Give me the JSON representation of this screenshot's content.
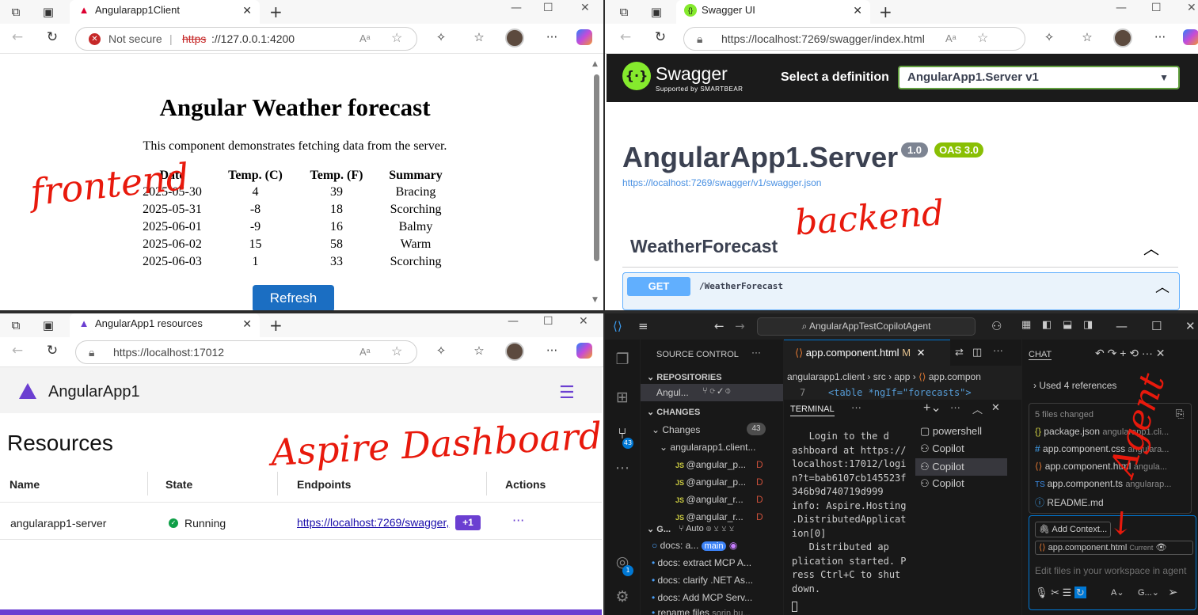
{
  "top_left": {
    "tab_title": "Angularapp1Client",
    "url_warning": "Not secure",
    "url_scheme": "https",
    "url_rest": "://127.0.0.1:4200",
    "heading": "Angular Weather forecast",
    "intro": "This component demonstrates fetching data from the server.",
    "columns": [
      "Date",
      "Temp. (C)",
      "Temp. (F)",
      "Summary"
    ],
    "rows": [
      [
        "2025-05-30",
        "4",
        "39",
        "Bracing"
      ],
      [
        "2025-05-31",
        "-8",
        "18",
        "Scorching"
      ],
      [
        "2025-06-01",
        "-9",
        "16",
        "Balmy"
      ],
      [
        "2025-06-02",
        "15",
        "58",
        "Warm"
      ],
      [
        "2025-06-03",
        "1",
        "33",
        "Scorching"
      ]
    ],
    "refresh_label": "Refresh",
    "annotation": "frontend"
  },
  "top_right": {
    "tab_title": "Swagger UI",
    "url": "https://localhost:7269/swagger/index.html",
    "brand": "Swagger",
    "brand_sub": "Supported by SMARTBEAR",
    "select_label": "Select a definition",
    "select_value": "AngularApp1.Server v1",
    "api_title": "AngularApp1.Server",
    "version_badge": "1.0",
    "oas_badge": "OAS 3.0",
    "spec_link": "https://localhost:7269/swagger/v1/swagger.json",
    "tag": "WeatherForecast",
    "method": "GET",
    "path": "/WeatherForecast",
    "annotation": "backend"
  },
  "bottom_left": {
    "tab_title": "AngularApp1 resources",
    "url": "https://localhost:17012",
    "app_name": "AngularApp1",
    "heading": "Resources",
    "columns": [
      "Name",
      "State",
      "Endpoints",
      "Actions"
    ],
    "resource_name": "angularapp1-server",
    "state": "Running",
    "endpoint": "https://localhost:7269/swagger,",
    "endpoint_more": "+1",
    "actions": "···",
    "annotation": "Aspire Dashboard"
  },
  "bottom_right": {
    "search": "AngularAppTestCopilotAgent",
    "source_control_title": "SOURCE CONTROL",
    "repositories": "REPOSITORIES",
    "repo_name": "Angul...",
    "changes_header": "CHANGES",
    "changes_label": "Changes",
    "changes_count": "43",
    "folder": "angularapp1.client...",
    "changed_files": [
      "@angular_p...",
      "@angular_p...",
      "@angular_r...",
      "@angular_r..."
    ],
    "file_status": "D",
    "graph_header": "G...",
    "graph_mode": "Auto",
    "commits": [
      "docs: a...",
      "docs: extract MCP A...",
      "docs: clarify .NET As...",
      "docs: Add MCP Serv...",
      "rename files"
    ],
    "commit_branch": "main",
    "commit_author": "sorin.bu...",
    "activity_badge_sc": "43",
    "activity_badge_acct": "1",
    "editor_tab": "app.component.html",
    "editor_tab_status": "M",
    "breadcrumb": [
      "angularapp1.client",
      "src",
      "app",
      "app.compon"
    ],
    "code_line_number": "7",
    "code_line": "<table *ngIf=\"forecasts\">",
    "terminal_title": "TERMINAL",
    "terminal_text": "   Login to the d\nashboard at https://\nlocalhost:17012/logi\nn?t=bab6107cb145523f\n346b9d740719d999\ninfo: Aspire.Hosting\n.DistributedApplicat\nion[0]\n   Distributed ap\nplication started. P\nress Ctrl+C to shut\ndown.",
    "terminals": [
      "powershell",
      "Copilot",
      "Copilot",
      "Copilot"
    ],
    "chat_title": "CHAT",
    "used_refs": "Used 4 references",
    "files_changed": "5 files changed",
    "chat_files": [
      {
        "name": "package.json",
        "path": "angularapp1.cli..."
      },
      {
        "name": "app.component.css",
        "path": "angulara..."
      },
      {
        "name": "app.component.html",
        "path": "angula..."
      },
      {
        "name": "app.component.ts",
        "path": "angularap..."
      },
      {
        "name": "README.md",
        "path": ""
      }
    ],
    "add_context": "Add Context...",
    "context_file": "app.component.html",
    "context_current": "Current",
    "chat_placeholder": "Edit files in your workspace in agent",
    "agent_mode": "A",
    "model": "G...",
    "annotation": "Agent"
  }
}
